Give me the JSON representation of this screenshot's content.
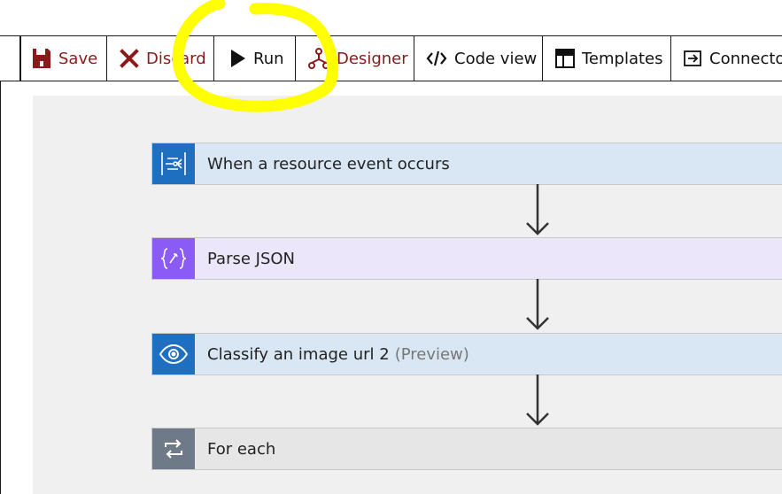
{
  "toolbar": {
    "save_label": "Save",
    "discard_label": "Discard",
    "run_label": "Run",
    "designer_label": "Designer",
    "codeview_label": "Code view",
    "templates_label": "Templates",
    "connectors_label": "Connecto"
  },
  "steps": [
    {
      "label": "When a resource event occurs",
      "color": "#1e6fc0",
      "bg": "#d9e7f5",
      "icon": "event-grid-icon"
    },
    {
      "label": "Parse JSON",
      "color": "#8a5cf5",
      "bg": "#ece6fb",
      "icon": "parse-json-icon"
    },
    {
      "label": "Classify an image url 2",
      "suffix": "(Preview)",
      "color": "#1e6fc0",
      "bg": "#d9e7f5",
      "icon": "eye-icon"
    },
    {
      "label": "For each",
      "color": "#6e7a87",
      "bg": "#e6e6e6",
      "icon": "loop-icon"
    }
  ],
  "colors": {
    "accent_red": "#8b1a1a",
    "highlight": "#ffff00"
  }
}
